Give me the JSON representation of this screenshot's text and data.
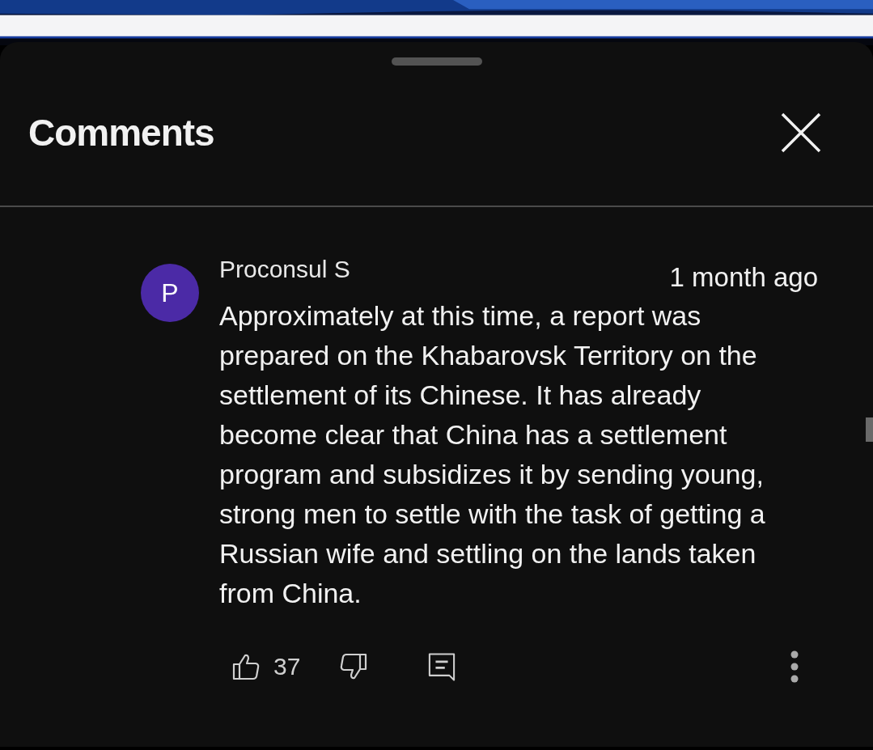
{
  "panel": {
    "title": "Comments"
  },
  "comments": [
    {
      "author": "Proconsul S",
      "initial": "P",
      "color": "#4b2aa6",
      "time": "1 month ago",
      "text": "Approximately at this time, a report was prepared on the Khabarovsk Territory on the settlement of its Chinese. It has already become clear that China has a settlement program and subsidizes it by sending young, strong men to settle with the task of getting a Russian wife and settling on the lands taken from China.",
      "likes": "37"
    }
  ]
}
